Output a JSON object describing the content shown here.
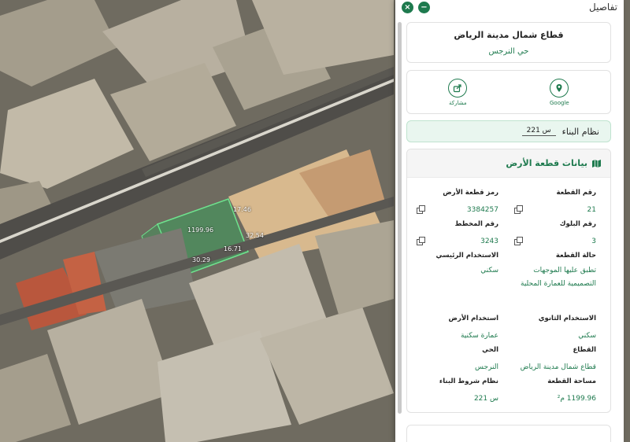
{
  "map": {
    "plot_labels": [
      "1199.96",
      "17.46",
      "32.54",
      "16.71",
      "30.29"
    ]
  },
  "panel": {
    "title": "تفاصيل",
    "buttons": {
      "close": "×",
      "minimize": "−"
    },
    "plot_title": "قطاع شمال مدينة الرياض",
    "district": "حي النرجس",
    "actions": {
      "share": "مشاركة",
      "google": "Google"
    },
    "building_system": {
      "label": "نظام البناء",
      "value": "س 221"
    },
    "land_data": {
      "title": "بيانات قطعة الأرض",
      "fields": {
        "plot_number": {
          "label": "رقم القطعة",
          "value": "21"
        },
        "plot_code": {
          "label": "رمز قطعة الأرض",
          "value": "3384257"
        },
        "block_number": {
          "label": "رقم البلوك",
          "value": "3"
        },
        "plan_number": {
          "label": "رقم المخطط",
          "value": "3243"
        },
        "plot_status": {
          "label": "حالة القطعة",
          "value": "تطبق عليها الموجهات التصميمية للعمارة المحلية"
        },
        "main_use": {
          "label": "الاستخدام الرئيسي",
          "value": "سكني"
        },
        "secondary_use": {
          "label": "الاستخدام الثانوي",
          "value": "سكني"
        },
        "land_use": {
          "label": "استخدام الأرض",
          "value": "عمارة سكنية"
        },
        "sector": {
          "label": "القطاع",
          "value": "قطاع شمال مدينة الرياض"
        },
        "district": {
          "label": "الحي",
          "value": "النرجس"
        },
        "area": {
          "label": "مساحة القطعة",
          "value": "1199.96 م²"
        },
        "building_code": {
          "label": "نظام شروط البناء",
          "value": "س 221"
        }
      }
    },
    "colors": {
      "accent": "#1e7a4e"
    }
  }
}
